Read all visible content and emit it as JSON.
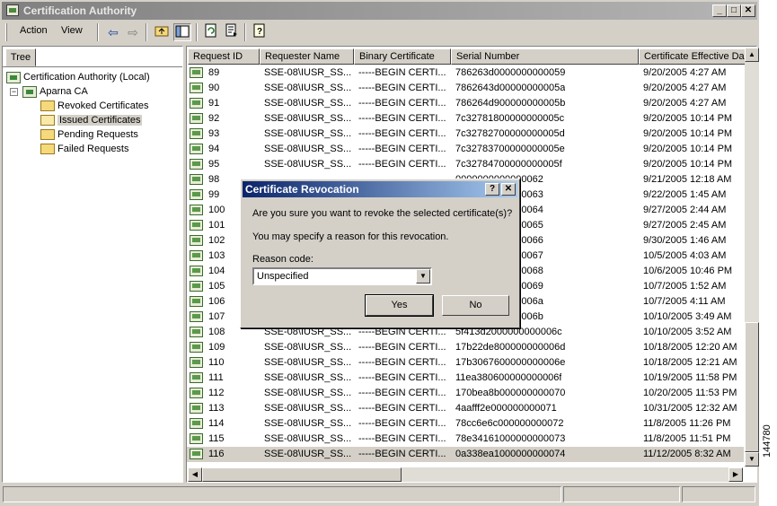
{
  "window": {
    "title": "Certification Authority",
    "minimize": "_",
    "maximize": "□",
    "close": "✕"
  },
  "menu": {
    "action": "Action",
    "view": "View"
  },
  "toolbar_icons": [
    "back-arrow-icon",
    "forward-arrow-icon",
    "up-folder-icon",
    "show-hide-tree-icon",
    "refresh-icon",
    "export-list-icon",
    "help-icon"
  ],
  "tree": {
    "tab": "Tree",
    "root": "Certification Authority (Local)",
    "ca": "Aparna CA",
    "ca_expander": "−",
    "folders": [
      "Revoked Certificates",
      "Issued Certificates",
      "Pending Requests",
      "Failed Requests"
    ],
    "selected": "Issued Certificates"
  },
  "columns": [
    "Request ID",
    "Requester Name",
    "Binary Certificate",
    "Serial Number",
    "Certificate Effective Da"
  ],
  "rows": [
    {
      "id": "89",
      "requester": "SSE-08\\IUSR_SS...",
      "binary": "-----BEGIN CERTI...",
      "serial": "786263d0000000000059",
      "effective": "9/20/2005 4:27 AM"
    },
    {
      "id": "90",
      "requester": "SSE-08\\IUSR_SS...",
      "binary": "-----BEGIN CERTI...",
      "serial": "7862643d00000000005a",
      "effective": "9/20/2005 4:27 AM"
    },
    {
      "id": "91",
      "requester": "SSE-08\\IUSR_SS...",
      "binary": "-----BEGIN CERTI...",
      "serial": "786264d900000000005b",
      "effective": "9/20/2005 4:27 AM"
    },
    {
      "id": "92",
      "requester": "SSE-08\\IUSR_SS...",
      "binary": "-----BEGIN CERTI...",
      "serial": "7c32781800000000005c",
      "effective": "9/20/2005 10:14 PM"
    },
    {
      "id": "93",
      "requester": "SSE-08\\IUSR_SS...",
      "binary": "-----BEGIN CERTI...",
      "serial": "7c32782700000000005d",
      "effective": "9/20/2005 10:14 PM"
    },
    {
      "id": "94",
      "requester": "SSE-08\\IUSR_SS...",
      "binary": "-----BEGIN CERTI...",
      "serial": "7c32783700000000005e",
      "effective": "9/20/2005 10:14 PM"
    },
    {
      "id": "95",
      "requester": "SSE-08\\IUSR_SS...",
      "binary": "-----BEGIN CERTI...",
      "serial": "7c32784700000000005f",
      "effective": "9/20/2005 10:14 PM"
    },
    {
      "id": "98",
      "requester": "",
      "binary": "",
      "serial": "0000000000000062",
      "effective": "9/21/2005 12:18 AM"
    },
    {
      "id": "99",
      "requester": "",
      "binary": "",
      "serial": "0000000000000063",
      "effective": "9/22/2005 1:45 AM"
    },
    {
      "id": "100",
      "requester": "",
      "binary": "",
      "serial": "0000000000000064",
      "effective": "9/27/2005 2:44 AM"
    },
    {
      "id": "101",
      "requester": "",
      "binary": "",
      "serial": "0000000000000065",
      "effective": "9/27/2005 2:45 AM"
    },
    {
      "id": "102",
      "requester": "",
      "binary": "",
      "serial": "0000000000000066",
      "effective": "9/30/2005 1:46 AM"
    },
    {
      "id": "103",
      "requester": "",
      "binary": "",
      "serial": "0000000000000067",
      "effective": "10/5/2005 4:03 AM"
    },
    {
      "id": "104",
      "requester": "",
      "binary": "",
      "serial": "0000000000000068",
      "effective": "10/6/2005 10:46 PM"
    },
    {
      "id": "105",
      "requester": "",
      "binary": "",
      "serial": "0000000000000069",
      "effective": "10/7/2005 1:52 AM"
    },
    {
      "id": "106",
      "requester": "",
      "binary": "",
      "serial": "000000000000006a",
      "effective": "10/7/2005 4:11 AM"
    },
    {
      "id": "107",
      "requester": "",
      "binary": "",
      "serial": "000000000000006b",
      "effective": "10/10/2005 3:49 AM"
    },
    {
      "id": "108",
      "requester": "SSE-08\\IUSR_SS...",
      "binary": "-----BEGIN CERTI...",
      "serial": "5f413d2000000000006c",
      "effective": "10/10/2005 3:52 AM"
    },
    {
      "id": "109",
      "requester": "SSE-08\\IUSR_SS...",
      "binary": "-----BEGIN CERTI...",
      "serial": "17b22de800000000006d",
      "effective": "10/18/2005 12:20 AM"
    },
    {
      "id": "110",
      "requester": "SSE-08\\IUSR_SS...",
      "binary": "-----BEGIN CERTI...",
      "serial": "17b3067600000000006e",
      "effective": "10/18/2005 12:21 AM"
    },
    {
      "id": "111",
      "requester": "SSE-08\\IUSR_SS...",
      "binary": "-----BEGIN CERTI...",
      "serial": "11ea380600000000006f",
      "effective": "10/19/2005 11:58 PM"
    },
    {
      "id": "112",
      "requester": "SSE-08\\IUSR_SS...",
      "binary": "-----BEGIN CERTI...",
      "serial": "170bea8b000000000070",
      "effective": "10/20/2005 11:53 PM"
    },
    {
      "id": "113",
      "requester": "SSE-08\\IUSR_SS...",
      "binary": "-----BEGIN CERTI...",
      "serial": "4aafff2e000000000071",
      "effective": "10/31/2005 12:32 AM"
    },
    {
      "id": "114",
      "requester": "SSE-08\\IUSR_SS...",
      "binary": "-----BEGIN CERTI...",
      "serial": "78cc6e6c000000000072",
      "effective": "11/8/2005 11:26 PM"
    },
    {
      "id": "115",
      "requester": "SSE-08\\IUSR_SS...",
      "binary": "-----BEGIN CERTI...",
      "serial": "78e34161000000000073",
      "effective": "11/8/2005 11:51 PM"
    },
    {
      "id": "116",
      "requester": "SSE-08\\IUSR_SS...",
      "binary": "-----BEGIN CERTI...",
      "serial": "0a338ea1000000000074",
      "effective": "11/12/2005 8:32 AM"
    }
  ],
  "selected_row": "116",
  "dialog": {
    "title": "Certificate Revocation",
    "help": "?",
    "close": "✕",
    "question": "Are you sure you want to revoke the selected certificate(s)?",
    "hint": "You may specify a reason for this revocation.",
    "reason_label": "Reason code:",
    "reason_value": "Unspecified",
    "yes": "Yes",
    "no": "No"
  },
  "figure_id": "144780"
}
